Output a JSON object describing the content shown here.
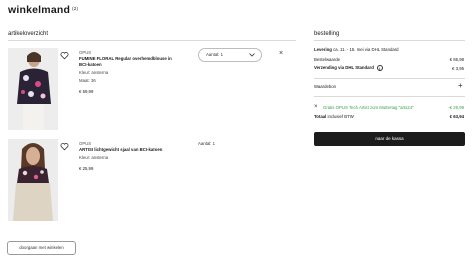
{
  "page": {
    "title": "winkelmand",
    "count": "(2)"
  },
  "articles": {
    "heading": "artikeloverzicht",
    "items": [
      {
        "brand": "OPUS",
        "name_line1": "FUMINE FLORAL Regular overhemdblouse in",
        "name_line2": "BCI-katoen",
        "color": "Kleur: ansterna",
        "size": "Maat: 36",
        "price": "€ 59,99",
        "quantity": "Aantal: 1"
      },
      {
        "brand": "OPUS",
        "name_line1": "ARTISI lichtgewicht sjaal van BCI-katoen",
        "color": "Kleur: ansterna",
        "price": "€ 25,99",
        "quantity": "Aantal: 1"
      }
    ]
  },
  "order": {
    "heading": "bestelling",
    "delivery_label": "Levering",
    "delivery_text": "ca. 11. - 15. mei via DHL Standard",
    "order_value_label": "Bestelwaarde",
    "order_value": "€ 85,98",
    "shipping_label": "Verzending via DHL Standard",
    "shipping_value": "€ 3,95",
    "voucher_label": "Waardebon",
    "discount_label": "Gratis OPUS Tech Artist zum Muttertag \"arts24\"",
    "discount_value": "-€ 25,99",
    "total_label": "Totaal",
    "total_note": "inclusief BTW",
    "total_value": "€ 63,94",
    "checkout_label": "naar de kassa"
  },
  "continue_label": "doorgaan met winkelen",
  "colors": {
    "accent_green": "#3aa24e",
    "checkout_bg": "#1c1c1c"
  }
}
